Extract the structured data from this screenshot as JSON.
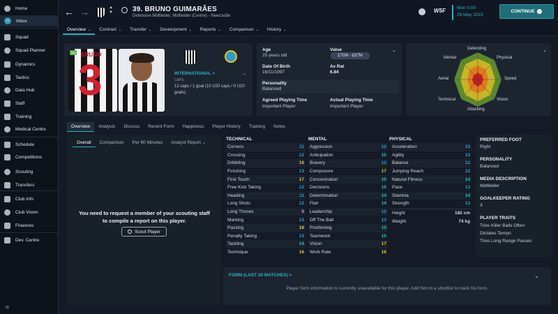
{
  "sidebar": {
    "items": [
      {
        "label": "Home",
        "icon": "home-icon"
      },
      {
        "label": "Inbox",
        "icon": "inbox-icon"
      },
      {
        "label": "Squad",
        "icon": "squad-icon"
      },
      {
        "label": "Squad Planner",
        "icon": "squad-planner-icon"
      },
      {
        "label": "Dynamics",
        "icon": "dynamics-icon"
      },
      {
        "label": "Tactics",
        "icon": "tactics-icon"
      },
      {
        "label": "Data Hub",
        "icon": "data-hub-icon"
      },
      {
        "label": "Staff",
        "icon": "staff-icon"
      },
      {
        "label": "Training",
        "icon": "training-icon"
      },
      {
        "label": "Medical Centre",
        "icon": "medical-icon"
      },
      {
        "label": "Schedule",
        "icon": "schedule-icon"
      },
      {
        "label": "Competitions",
        "icon": "competitions-icon"
      },
      {
        "label": "Scouting",
        "icon": "scouting-icon"
      },
      {
        "label": "Transfers",
        "icon": "transfers-icon"
      },
      {
        "label": "Club Info",
        "icon": "club-info-icon"
      },
      {
        "label": "Club Vision",
        "icon": "club-vision-icon"
      },
      {
        "label": "Finances",
        "icon": "finances-icon"
      },
      {
        "label": "Dev. Centre",
        "icon": "dev-centre-icon"
      }
    ],
    "inbox_badge": "23",
    "footer": "⊞"
  },
  "header": {
    "player_name": "39. BRUNO GUIMARÃES",
    "subtitle": "Defensive Midfielder, Midfielder (Centre) - Newcastle",
    "date_day": "Mon 0:00",
    "date": "29 May 2023",
    "continue_label": "CONTINUE",
    "tabs": [
      {
        "label": "Overview",
        "active": true
      },
      {
        "label": "Contract",
        "active": false
      },
      {
        "label": "Transfer",
        "active": false
      },
      {
        "label": "Development",
        "active": false
      },
      {
        "label": "Reports",
        "active": false
      },
      {
        "label": "Comparison",
        "active": false
      },
      {
        "label": "History",
        "active": false
      }
    ],
    "logo_text": "W5F"
  },
  "profile": {
    "shirt_number": "3",
    "shirt_text": "BRUNO",
    "badge": "Sel",
    "international_label": "INTERNATIONAL >",
    "caps_label": "CAPS",
    "caps_value": "12 caps / 1 goal (10 U20 caps / 0 U20 goals)"
  },
  "info": {
    "age_label": "Age",
    "age_value": "25 years old",
    "value_label": "Value",
    "value_value": "£70M - £87M",
    "dob_label": "Date Of Birth",
    "dob_value": "16/11/1997",
    "avrat_label": "Av Rat",
    "avrat_value": "6.84",
    "personality_label": "Personality",
    "personality_value": "Balanced",
    "agreed_pt_label": "Agreed Playing Time",
    "agreed_pt_value": "Important Player",
    "actual_pt_label": "Actual Playing Time",
    "actual_pt_value": "Important Player"
  },
  "radar": {
    "labels": [
      "Defending",
      "Physical",
      "Speed",
      "Vision",
      "Attacking",
      "Technical",
      "Aerial",
      "Mental"
    ]
  },
  "subtabs": [
    {
      "label": "Overview",
      "active": true
    },
    {
      "label": "Analysis",
      "active": false
    },
    {
      "label": "Discuss",
      "active": false
    },
    {
      "label": "Recent Form",
      "active": false
    },
    {
      "label": "Happiness",
      "active": false
    },
    {
      "label": "Player History",
      "active": false
    },
    {
      "label": "Training",
      "active": false
    },
    {
      "label": "Notes",
      "active": false
    }
  ],
  "report": {
    "tabs": [
      {
        "label": "Overall",
        "active": true
      },
      {
        "label": "Comparison",
        "active": false
      },
      {
        "label": "Per 90 Minutes",
        "active": false
      },
      {
        "label": "Analyst Report",
        "active": false
      }
    ],
    "message": "You need to request a member of your scouting staff to compile a report on this player.",
    "scout_button": "Scout Player"
  },
  "attributes": {
    "technical_title": "TECHNICAL",
    "mental_title": "MENTAL",
    "physical_title": "PHYSICAL",
    "technical": [
      {
        "name": "Corners",
        "value": "11",
        "color": "blue"
      },
      {
        "name": "Crossing",
        "value": "12",
        "color": "blue"
      },
      {
        "name": "Dribbling",
        "value": "16",
        "color": "yellow"
      },
      {
        "name": "Finishing",
        "value": "13",
        "color": "blue"
      },
      {
        "name": "First Touch",
        "value": "17",
        "color": "yellow"
      },
      {
        "name": "Free Kick Taking",
        "value": "12",
        "color": "blue"
      },
      {
        "name": "Heading",
        "value": "11",
        "color": "blue"
      },
      {
        "name": "Long Shots",
        "value": "12",
        "color": "blue"
      },
      {
        "name": "Long Throws",
        "value": "5",
        "color": "grey"
      },
      {
        "name": "Marking",
        "value": "13",
        "color": "blue"
      },
      {
        "name": "Passing",
        "value": "18",
        "color": "yellow"
      },
      {
        "name": "Penalty Taking",
        "value": "13",
        "color": "blue"
      },
      {
        "name": "Tackling",
        "value": "14",
        "color": "cyan"
      },
      {
        "name": "Technique",
        "value": "16",
        "color": "yellow"
      }
    ],
    "mental": [
      {
        "name": "Aggression",
        "value": "12",
        "color": "blue"
      },
      {
        "name": "Anticipation",
        "value": "15",
        "color": "cyan"
      },
      {
        "name": "Bravery",
        "value": "12",
        "color": "blue"
      },
      {
        "name": "Composure",
        "value": "17",
        "color": "yellow"
      },
      {
        "name": "Concentration",
        "value": "15",
        "color": "cyan"
      },
      {
        "name": "Decisions",
        "value": "15",
        "color": "cyan"
      },
      {
        "name": "Determination",
        "value": "14",
        "color": "cyan"
      },
      {
        "name": "Flair",
        "value": "14",
        "color": "cyan"
      },
      {
        "name": "Leadership",
        "value": "12",
        "color": "blue"
      },
      {
        "name": "Off The Ball",
        "value": "13",
        "color": "blue"
      },
      {
        "name": "Positioning",
        "value": "15",
        "color": "cyan"
      },
      {
        "name": "Teamwork",
        "value": "15",
        "color": "cyan"
      },
      {
        "name": "Vision",
        "value": "17",
        "color": "yellow"
      },
      {
        "name": "Work Rate",
        "value": "16",
        "color": "yellow"
      }
    ],
    "physical": [
      {
        "name": "Acceleration",
        "value": "13",
        "color": "blue"
      },
      {
        "name": "Agility",
        "value": "13",
        "color": "blue"
      },
      {
        "name": "Balance",
        "value": "12",
        "color": "blue"
      },
      {
        "name": "Jumping Reach",
        "value": "12",
        "color": "blue"
      },
      {
        "name": "Natural Fitness",
        "value": "14",
        "color": "cyan"
      },
      {
        "name": "Pace",
        "value": "13",
        "color": "blue"
      },
      {
        "name": "Stamina",
        "value": "14",
        "color": "cyan"
      },
      {
        "name": "Strength",
        "value": "13",
        "color": "blue"
      }
    ],
    "height_label": "Height",
    "height_value": "182 cm",
    "weight_label": "Weight",
    "weight_value": "74 kg"
  },
  "side": {
    "preferred_foot_label": "PREFERRED FOOT",
    "preferred_foot_value": "Right",
    "personality_label": "PERSONALITY",
    "personality_value": "Balanced",
    "media_label": "MEDIA DESCRIPTION",
    "media_value": "Midfielder",
    "gk_label": "GOALKEEPER RATING",
    "gk_value": "3",
    "traits_label": "PLAYER TRAITS",
    "traits": [
      "Tries Killer Balls Often",
      "Dictates Tempo",
      "Tries Long Range Passes"
    ]
  },
  "form": {
    "title": "FORM (LAST 20 MATCHES) >",
    "message": "Player form information is currently unavailable for this player. Add him to a shortlist to track his form."
  },
  "colors": {
    "accent": "#27b4c6",
    "blue": "#2aa4e0",
    "cyan": "#27c4d4",
    "yellow": "#e7c93a",
    "grey": "#b9c0ca"
  }
}
